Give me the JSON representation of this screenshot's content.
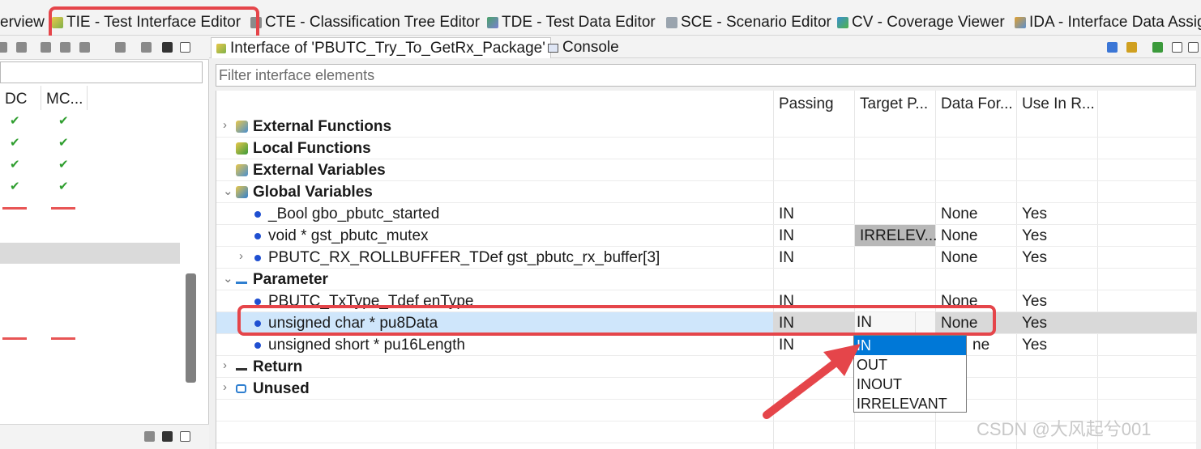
{
  "perspective_tabs": [
    {
      "label": "erview",
      "icon": "overview-icon"
    },
    {
      "label": "TIE - Test Interface Editor",
      "icon": "tie-icon",
      "active": true
    },
    {
      "label": "CTE - Classification Tree Editor",
      "icon": "cte-icon"
    },
    {
      "label": "TDE - Test Data Editor",
      "icon": "tde-icon"
    },
    {
      "label": "SCE - Scenario Editor",
      "icon": "sce-icon"
    },
    {
      "label": "CV - Coverage Viewer",
      "icon": "cv-icon"
    },
    {
      "label": "IDA - Interface Data Assig",
      "icon": "ida-icon"
    }
  ],
  "left_pane": {
    "columns": [
      "DC",
      "MC..."
    ],
    "check_rows": 4
  },
  "editor_tabs": [
    {
      "label": "Interface of 'PBUTC_Try_To_GetRx_Package'",
      "icon": "interface-icon",
      "active": true
    },
    {
      "label": "Console",
      "icon": "console-icon",
      "active": false
    }
  ],
  "filter": {
    "placeholder": "Filter interface elements"
  },
  "columns": [
    "Passing",
    "Target P...",
    "Data For...",
    "Use In R..."
  ],
  "rows": [
    {
      "label": "External Functions",
      "bold": true,
      "twisty": "›",
      "icon": "external-functions-icon",
      "passing": "",
      "target": "",
      "data": "",
      "use": ""
    },
    {
      "label": "Local Functions",
      "bold": true,
      "twisty": "",
      "icon": "local-functions-icon",
      "passing": "",
      "target": "",
      "data": "",
      "use": ""
    },
    {
      "label": "External Variables",
      "bold": true,
      "twisty": "",
      "icon": "external-variables-icon",
      "passing": "",
      "target": "",
      "data": "",
      "use": ""
    },
    {
      "label": "Global Variables",
      "bold": true,
      "twisty": "⌄",
      "icon": "global-variables-icon",
      "passing": "",
      "target": "",
      "data": "",
      "use": ""
    },
    {
      "label": "_Bool gbo_pbutc_started",
      "bold": false,
      "twisty": "",
      "icon": "dot",
      "passing": "IN",
      "target": "",
      "data": "None",
      "use": "Yes"
    },
    {
      "label": "void * gst_pbutc_mutex",
      "bold": false,
      "twisty": "",
      "icon": "dot",
      "passing": "IN",
      "target": "IRRELEV...",
      "data": "None",
      "use": "Yes"
    },
    {
      "label": "PBUTC_RX_ROLLBUFFER_TDef gst_pbutc_rx_buffer[3]",
      "bold": false,
      "twisty": "›",
      "icon": "dot",
      "passing": "IN",
      "target": "",
      "data": "None",
      "use": "Yes"
    },
    {
      "label": "Parameter",
      "bold": true,
      "twisty": "⌄",
      "icon": "parameter-icon",
      "passing": "",
      "target": "",
      "data": "",
      "use": ""
    },
    {
      "label": "PBUTC_TxType_Tdef enType",
      "bold": false,
      "twisty": "",
      "icon": "dot",
      "passing": "IN",
      "target": "",
      "data": "None",
      "use": "Yes"
    },
    {
      "label": "unsigned char * pu8Data",
      "bold": false,
      "twisty": "",
      "icon": "dot",
      "passing": "IN",
      "target": "IN",
      "data": "None",
      "use": "Yes",
      "selected": true
    },
    {
      "label": "unsigned short * pu16Length",
      "bold": false,
      "twisty": "",
      "icon": "dot",
      "passing": "IN",
      "target": "",
      "data": "ne",
      "use": "Yes"
    },
    {
      "label": "Return",
      "bold": true,
      "twisty": "›",
      "icon": "return-icon",
      "passing": "",
      "target": "",
      "data": "",
      "use": ""
    },
    {
      "label": "Unused",
      "bold": true,
      "twisty": "›",
      "icon": "unused-icon",
      "passing": "",
      "target": "",
      "data": "",
      "use": ""
    }
  ],
  "dropdown": {
    "options": [
      "IN",
      "OUT",
      "INOUT",
      "IRRELEVANT"
    ],
    "selected_index": 0
  },
  "watermark": "CSDN @大风起兮001",
  "colors": {
    "highlight": "#e5454a",
    "selection": "#0078d7",
    "dot": "#1f4fd1",
    "check": "#2f9e2f"
  }
}
